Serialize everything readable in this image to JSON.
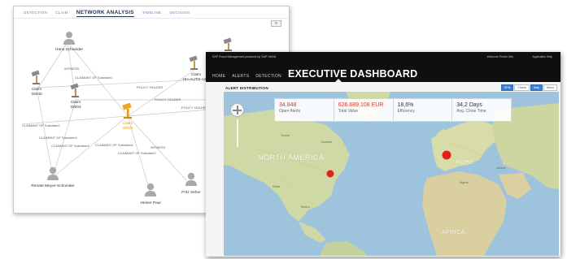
{
  "network_window": {
    "tabs": [
      {
        "label": "DETECTION",
        "active": false
      },
      {
        "label": "CLAIM",
        "active": false
      },
      {
        "label": "NETWORK ANALYSIS",
        "active": true
      },
      {
        "label": "TIMELINE",
        "active": false
      },
      {
        "label": "DECISION",
        "active": false
      }
    ],
    "search_icon": "search-icon",
    "people": [
      {
        "name": "Hans Schneider"
      },
      {
        "name": "Renate Meyer-Schneider"
      },
      {
        "name": "Heiner Paul"
      },
      {
        "name": "Fritz Seher"
      }
    ],
    "claims": [
      {
        "label": "Claim",
        "number": "33040"
      },
      {
        "label": "Claim",
        "number": "33004"
      },
      {
        "label": "Claim",
        "number": "33021"
      },
      {
        "label": "Claim",
        "number": "HH-AUTO-12..."
      }
    ],
    "edge_labels": [
      "WITNESS",
      "CLAIMANT OF Subclaim1",
      "POLICY HOLDER",
      "POLICY HOLDER",
      "POLICY HOLDER",
      "CLAIMANT OF Subclaim2",
      "CLAIMANT OF Subclaim3",
      "CLAIMANT OF Subclaim4",
      "CLAIMANT OF Subclaim5",
      "WITNESS",
      "CLAIMANT OF Subclaim2"
    ],
    "colors": {
      "claim_highlight": "#f2a31a",
      "node_gray": "#a9a9a9",
      "edge": "#c8c8c8"
    }
  },
  "dashboard_window": {
    "brand": "SAP Fraud Management powered by SAP HANA",
    "user": "Welcome Tineke Otto",
    "app_label": "Application Help",
    "nav": [
      {
        "label": "HOME"
      },
      {
        "label": "ALERTS"
      },
      {
        "label": "DETECTION"
      }
    ],
    "title": "EXECUTIVE DASHBOARD",
    "section_title": "ALERT DISTRIBUTION",
    "view_buttons": [
      {
        "label": "KPIs",
        "active": true
      },
      {
        "label": "Charts",
        "active": false
      },
      {
        "label": "Map",
        "active": true
      },
      {
        "label": "Menu",
        "active": false
      }
    ],
    "kpis": [
      {
        "value": "34.848",
        "label": "Open Alerts",
        "highlight": true
      },
      {
        "value": "626.689.108 EUR",
        "label": "Total Value",
        "highlight": true
      },
      {
        "value": "18,6%",
        "label": "Efficiency",
        "highlight": false
      },
      {
        "value": "34,2 Days",
        "label": "Avg. Close Time",
        "highlight": false
      }
    ],
    "map_labels": {
      "na": "NORTH AMERICA",
      "eu": "ROPE",
      "af": "AFRICA"
    },
    "map_cities": [
      "Toronto",
      "Montreal",
      "Dallas",
      "Mexico",
      "Algeria",
      "Ukraine"
    ],
    "zoom_icon": "pan-zoom-icon",
    "alert_markers": [
      {
        "region": "North America (US East)"
      },
      {
        "region": "Europe (Germany)"
      }
    ],
    "colors": {
      "topbar": "#0f0f10",
      "ocean": "#9ec3dc",
      "land": "#cfd9a5",
      "marker": "#e0201c",
      "accent": "#3d7fd1"
    }
  }
}
